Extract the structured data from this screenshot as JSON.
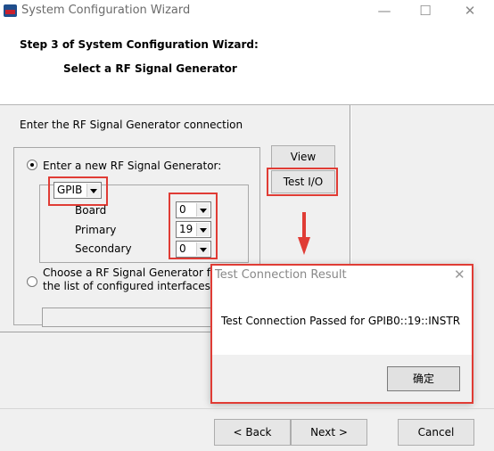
{
  "window": {
    "title": "System Configuration Wizard",
    "minimize": "—",
    "maximize": "☐",
    "close": "✕"
  },
  "header": {
    "step_title": "Step 3 of System Configuration Wizard:",
    "step_subtitle": "Select a RF Signal Generator"
  },
  "main": {
    "prompt": "Enter the RF Signal Generator connection",
    "option_new": "Enter a new RF Signal Generator:",
    "option_choose_line1": "Choose a RF Signal Generator f",
    "option_choose_line2": "the list of configured interfaces",
    "interface_type": "GPIB",
    "fields": {
      "board_label": "Board",
      "board_value": "0",
      "primary_label": "Primary",
      "primary_value": "19",
      "secondary_label": "Secondary",
      "secondary_value": "0"
    },
    "view_button": "View",
    "test_io_button": "Test I/O"
  },
  "dialog": {
    "title": "Test Connection Result",
    "message": "Test Connection Passed for GPIB0::19::INSTR",
    "ok_button": "确定",
    "close": "✕"
  },
  "footer": {
    "back_button": "< Back",
    "next_button": "Next >",
    "cancel_button": "Cancel"
  },
  "colors": {
    "highlight": "#e03c35",
    "dialog_background": "#ffffff",
    "window_background": "#f0f0f0"
  },
  "icons": [
    "app-icon",
    "down-arrow-icon",
    "close-icon",
    "radio-selected-icon"
  ]
}
